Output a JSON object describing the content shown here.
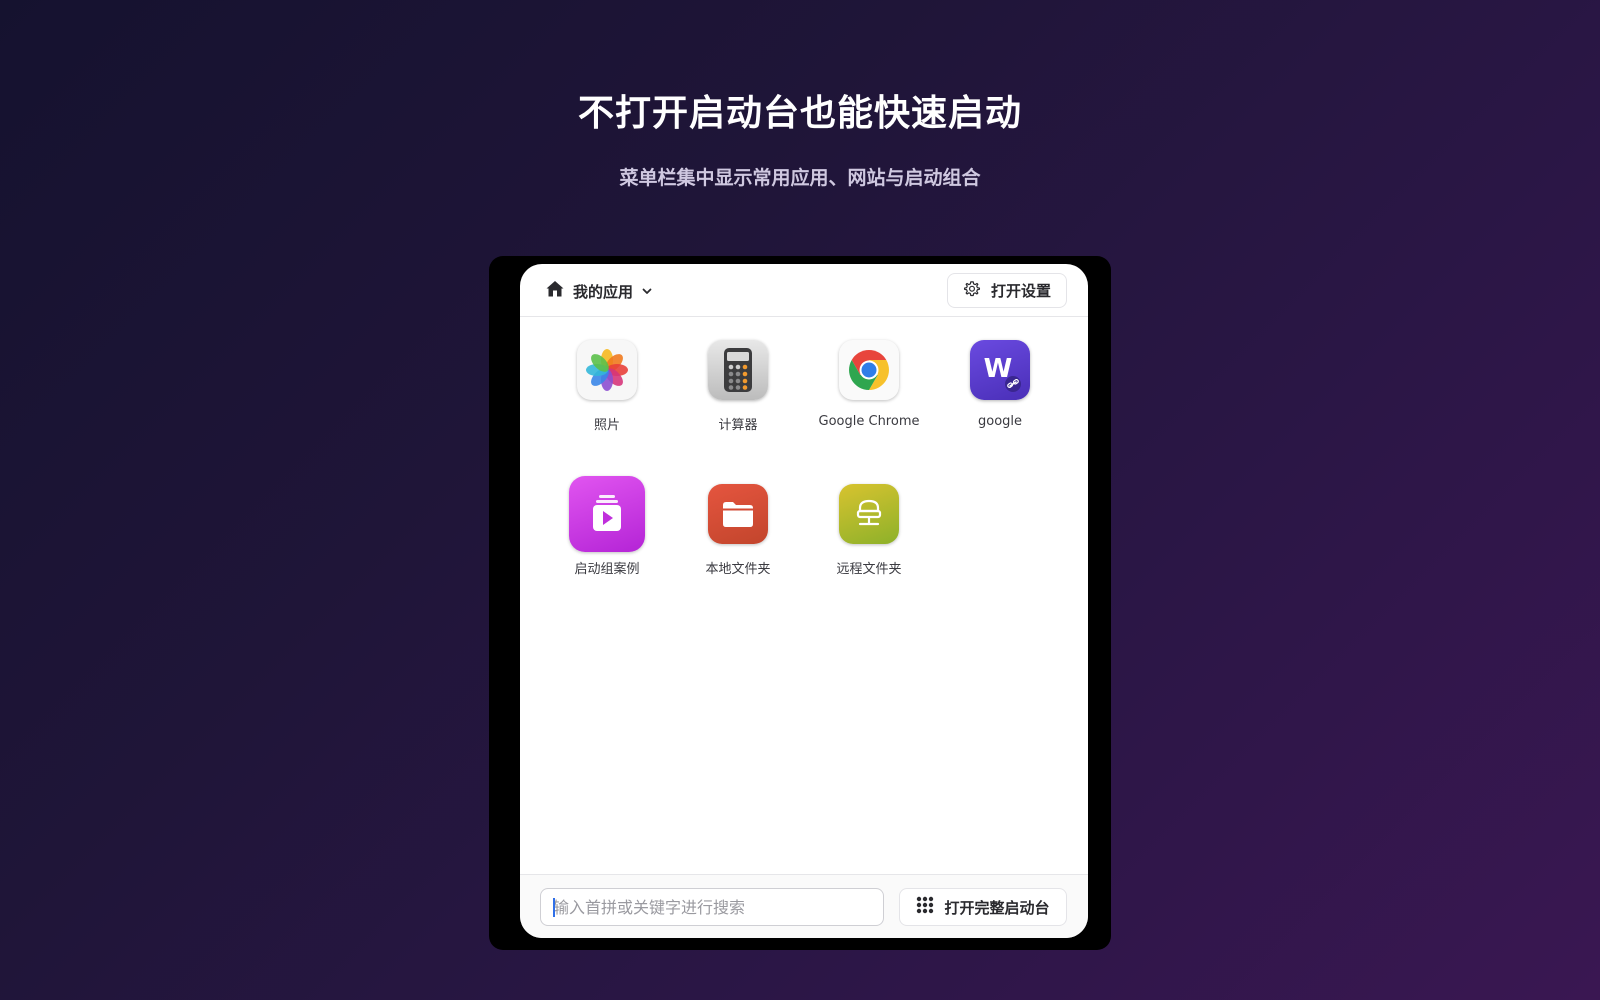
{
  "hero": {
    "title": "不打开启动台也能快速启动",
    "subtitle": "菜单栏集中显示常用应用、网站与启动组合"
  },
  "header": {
    "group_icon": "home-icon",
    "group_label": "我的应用",
    "group_chevron": "chevron-down-icon",
    "settings_icon": "gear-icon",
    "settings_label": "打开设置"
  },
  "apps": [
    {
      "label": "照片",
      "icon": "photos-icon"
    },
    {
      "label": "计算器",
      "icon": "calculator-icon"
    },
    {
      "label": "Google Chrome",
      "icon": "chrome-icon"
    },
    {
      "label": "google",
      "icon": "web-link-icon"
    },
    {
      "label": "启动组案例",
      "icon": "launch-group-icon"
    },
    {
      "label": "本地文件夹",
      "icon": "local-folder-icon"
    },
    {
      "label": "远程文件夹",
      "icon": "remote-folder-icon"
    }
  ],
  "footer": {
    "search_placeholder": "输入首拼或关键字进行搜索",
    "launchpad_icon": "grid-icon",
    "launchpad_label": "打开完整启动台"
  },
  "colors": {
    "background_start": "#15122f",
    "background_end": "#3a1752",
    "panel": "#ffffff",
    "caret": "#2f6fe8"
  }
}
